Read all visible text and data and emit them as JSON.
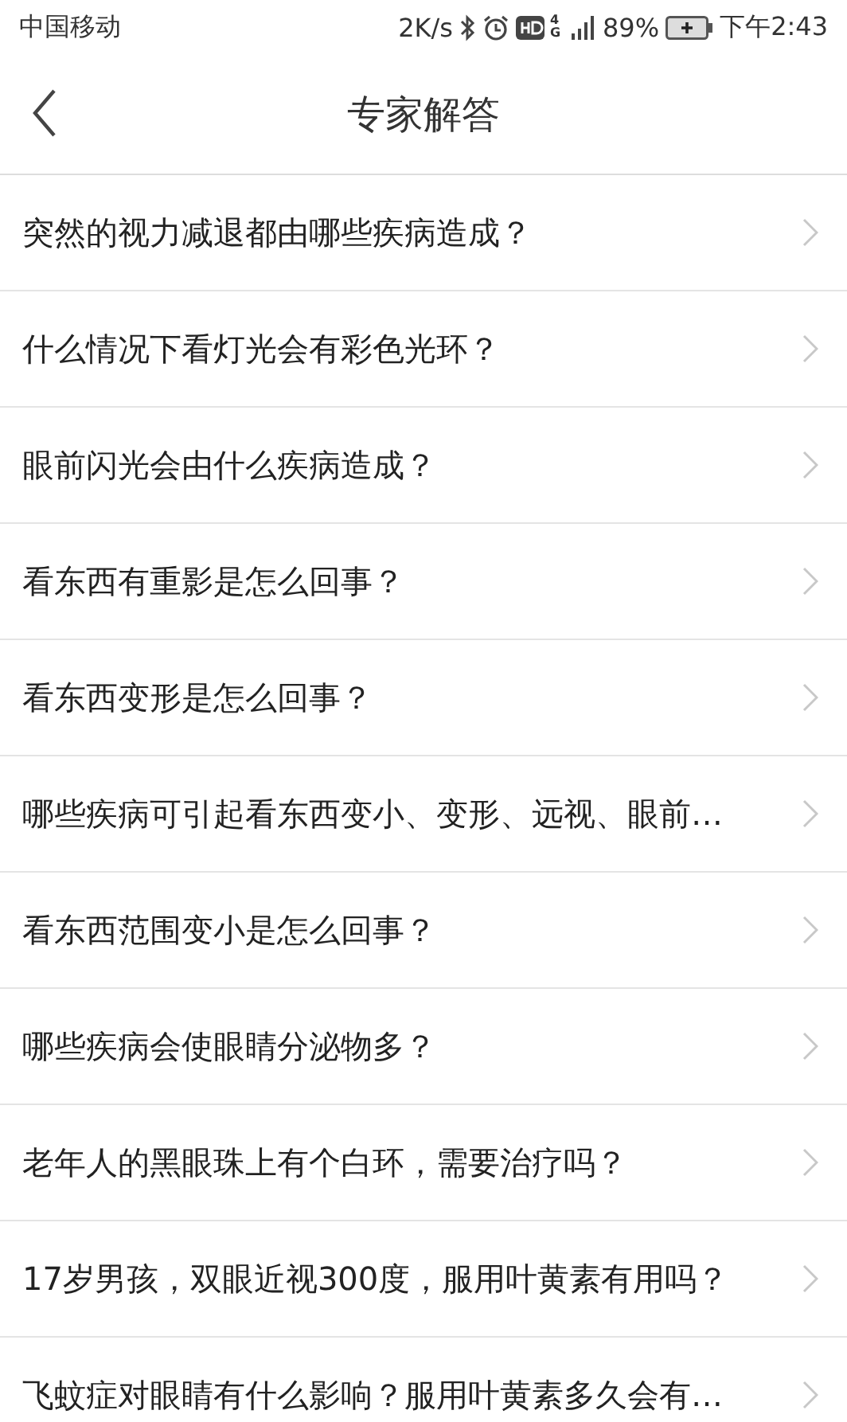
{
  "status_bar": {
    "carrier": "中国移动",
    "speed": "2K/s",
    "network": "4G",
    "battery": "89%",
    "time": "下午2:43"
  },
  "nav": {
    "title": "专家解答"
  },
  "questions": [
    {
      "text": "突然的视力减退都由哪些疾病造成？"
    },
    {
      "text": "什么情况下看灯光会有彩色光环？"
    },
    {
      "text": "眼前闪光会由什么疾病造成？"
    },
    {
      "text": "看东西有重影是怎么回事？"
    },
    {
      "text": "看东西变形是怎么回事？"
    },
    {
      "text": "哪些疾病可引起看东西变小、变形、远视、眼前…"
    },
    {
      "text": "看东西范围变小是怎么回事？"
    },
    {
      "text": "哪些疾病会使眼睛分泌物多？"
    },
    {
      "text": "老年人的黑眼珠上有个白环，需要治疗吗？"
    },
    {
      "text": "17岁男孩，双眼近视300度，服用叶黄素有用吗？"
    },
    {
      "text": "飞蚊症对眼睛有什么影响？服用叶黄素多久会有…"
    }
  ]
}
